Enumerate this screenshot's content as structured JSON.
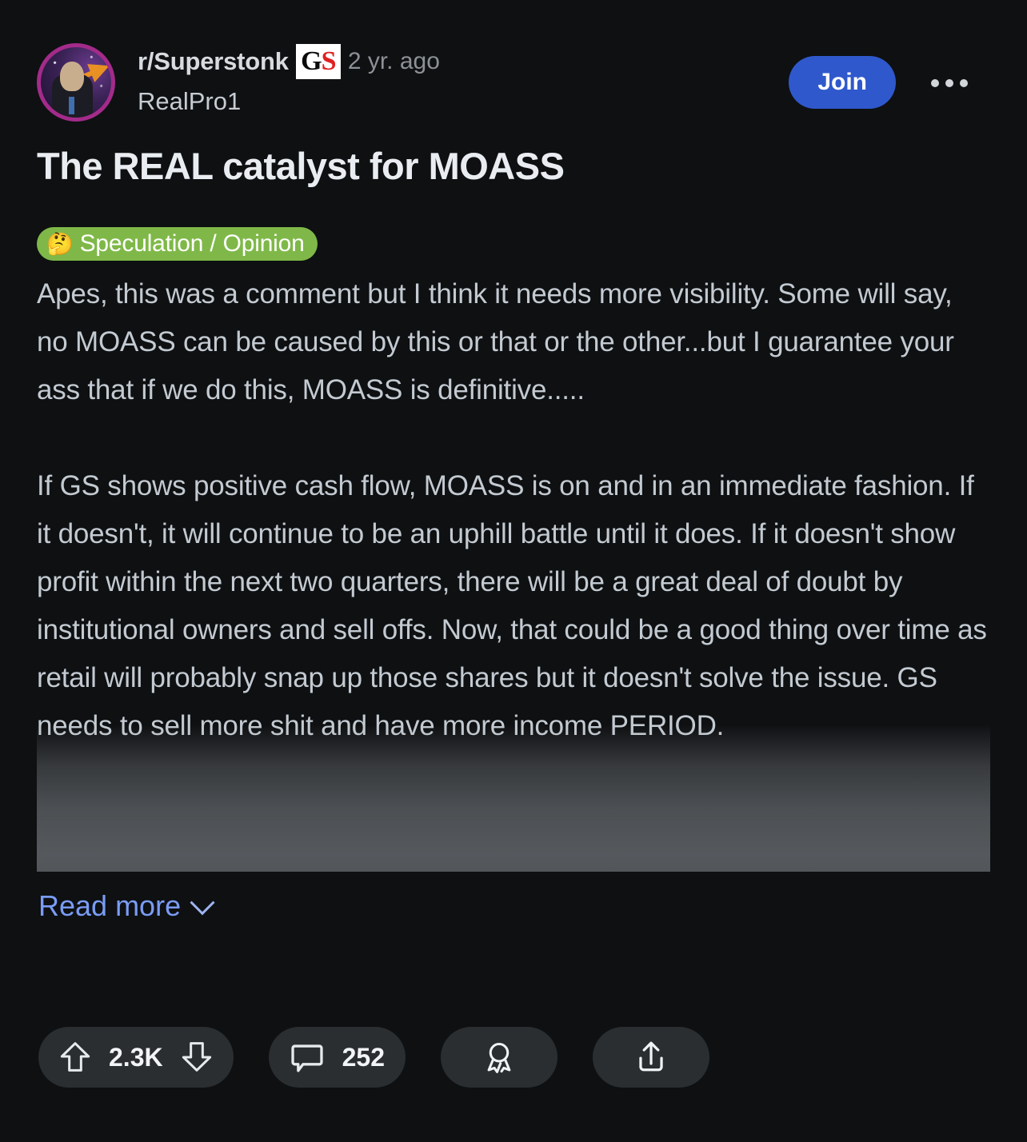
{
  "post": {
    "subreddit": "r/Superstonk",
    "community_badge": {
      "first_letter": "G",
      "second_letter": "S"
    },
    "timestamp": "2 yr. ago",
    "username": "RealPro1",
    "join_label": "Join",
    "title": "The REAL catalyst for MOASS",
    "flair": {
      "emoji": "🤔",
      "label": "Speculation / Opinion"
    },
    "body": "Apes, this was a comment but I think it needs more visibility. Some will say, no MOASS can be caused by this or that or the other...but I guarantee your ass that if we do this, MOASS is definitive.....\n\nIf GS shows positive cash flow, MOASS is on and in an immediate fashion. If it doesn't, it will continue to be an uphill battle until it does. If it doesn't show profit within the next two quarters, there will be a great deal of doubt by institutional owners and sell offs. Now, that could be a good thing over time as retail will probably snap up those shares but it doesn't solve the issue. GS needs to sell more shit and have more income PERIOD.",
    "read_more_label": "Read more",
    "actions": {
      "upvote_count": "2.3K",
      "comment_count": "252"
    }
  },
  "colors": {
    "page_background": "#0e1012",
    "join_button": "#2f58cc",
    "flair_green": "#7fb848",
    "link_blue": "#7a9cf5",
    "pill_background": "#2a2e31",
    "avatar_ring": "#a32b8a",
    "badge_accent_red": "#e02020"
  }
}
